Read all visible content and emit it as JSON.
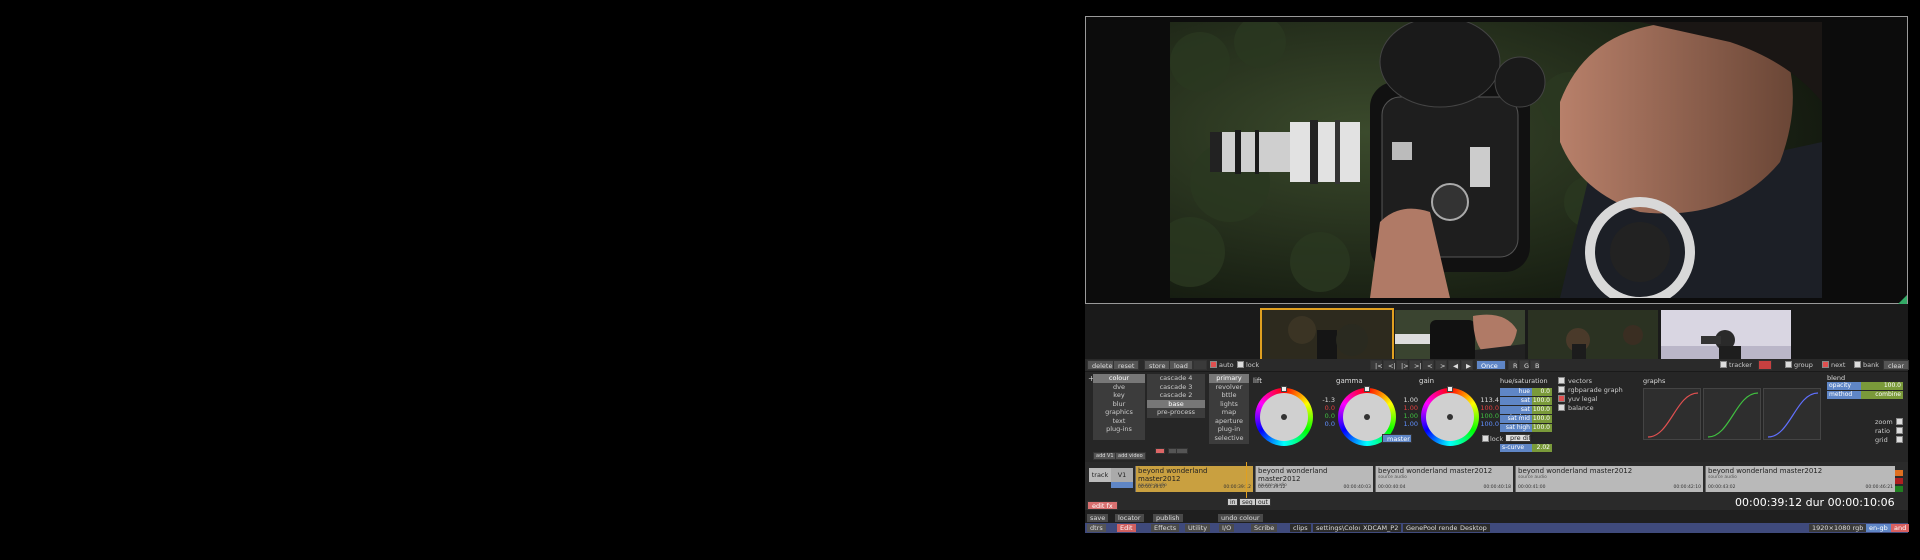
{
  "toolbar": {
    "delete": "delete",
    "reset": "reset",
    "store": "store",
    "load": "load",
    "auto": "auto",
    "lock": "lock",
    "mode": "Once",
    "tracker": "tracker",
    "group": "group",
    "next": "next",
    "bank": "bank",
    "clear": "clear"
  },
  "left_menu": [
    "colour",
    "dve",
    "key",
    "blur",
    "graphics",
    "text",
    "plug-ins"
  ],
  "cascade_menu": [
    "cascade 4",
    "cascade 3",
    "cascade 2",
    "base",
    "pre-process"
  ],
  "primary_menu": [
    "primary",
    "revolver",
    "bttle",
    "lights",
    "map",
    "aperture",
    "plug-in",
    "selective"
  ],
  "wheels": [
    {
      "title": "lift",
      "vals": [
        "-1.3",
        "0.0",
        "0.0",
        "0.0"
      ]
    },
    {
      "title": "gamma",
      "vals": [
        "1.00",
        "1.00",
        "1.00",
        "1.00"
      ]
    },
    {
      "title": "gain",
      "vals": [
        "113.4",
        "100.0",
        "100.0",
        "100.0"
      ]
    }
  ],
  "master_label": "master",
  "lock_label": "lock",
  "hue_sat": {
    "title": "hue/saturation",
    "rows": [
      {
        "k": "hue",
        "v": "0.0"
      },
      {
        "k": "sat",
        "v": "100.0"
      },
      {
        "k": "sat shadow",
        "v": "100.0"
      },
      {
        "k": "sat mid",
        "v": "100.0"
      },
      {
        "k": "sat high",
        "v": "100.0"
      }
    ],
    "pre_diff": "pre diff",
    "s_curve": "s-curve",
    "s_curve_val": "2.02"
  },
  "scopes": [
    "vectors",
    "rgbparade graph",
    "yuv legal",
    "balance"
  ],
  "graphs_title": "graphs",
  "blend": {
    "title": "blend",
    "opacity_label": "opacity",
    "opacity_val": "100.0",
    "method_label": "method",
    "method_val": "combine",
    "zoom": "zoom",
    "ratio": "ratio",
    "grid": "grid"
  },
  "timeline": {
    "add_v": "add V1",
    "add_vfx": "add video",
    "track": "track",
    "v1": "V1",
    "in": "in",
    "seg": "seg",
    "out": "out",
    "clips": [
      {
        "name": "beyond wonderland master2012",
        "sub": "source audio",
        "tc1": "00:00:39:07",
        "tc2": "00:00:39:12"
      },
      {
        "name": "beyond wonderland master2012",
        "sub": "source audio",
        "tc1": "00:00:39:12",
        "tc2": "00:00:40:03"
      },
      {
        "name": "beyond wonderland master2012",
        "sub": "source audio",
        "tc1": "00:00:40:04",
        "tc2": "00:00:40:18"
      },
      {
        "name": "beyond wonderland master2012",
        "sub": "source audio",
        "tc1": "00:00:41:00",
        "tc2": "00:00:42:10"
      },
      {
        "name": "beyond wonderland master2012",
        "sub": "source audio",
        "tc1": "00:00:43:02",
        "tc2": "00:00:46:21"
      }
    ]
  },
  "edit_fx": "edit fx",
  "timecode": "00:00:39:12 dur 00:00:10:06",
  "bottom1": [
    "save",
    "locator",
    "publish"
  ],
  "undo": "undo colour",
  "bottom2": [
    "dtrs",
    "Edit",
    "Effects",
    "Utility",
    "I/O",
    "Scribe"
  ],
  "path": [
    "clips",
    "settings\\Colour",
    "XDCAM_P2",
    "GenePool render",
    "Desktop"
  ],
  "format": "1920×1080 rgb",
  "flags": [
    "en-gb",
    "and"
  ],
  "colors": {
    "accent": "#e0a020",
    "blue": "#5f86c6",
    "bar": "#3f4a7c"
  }
}
